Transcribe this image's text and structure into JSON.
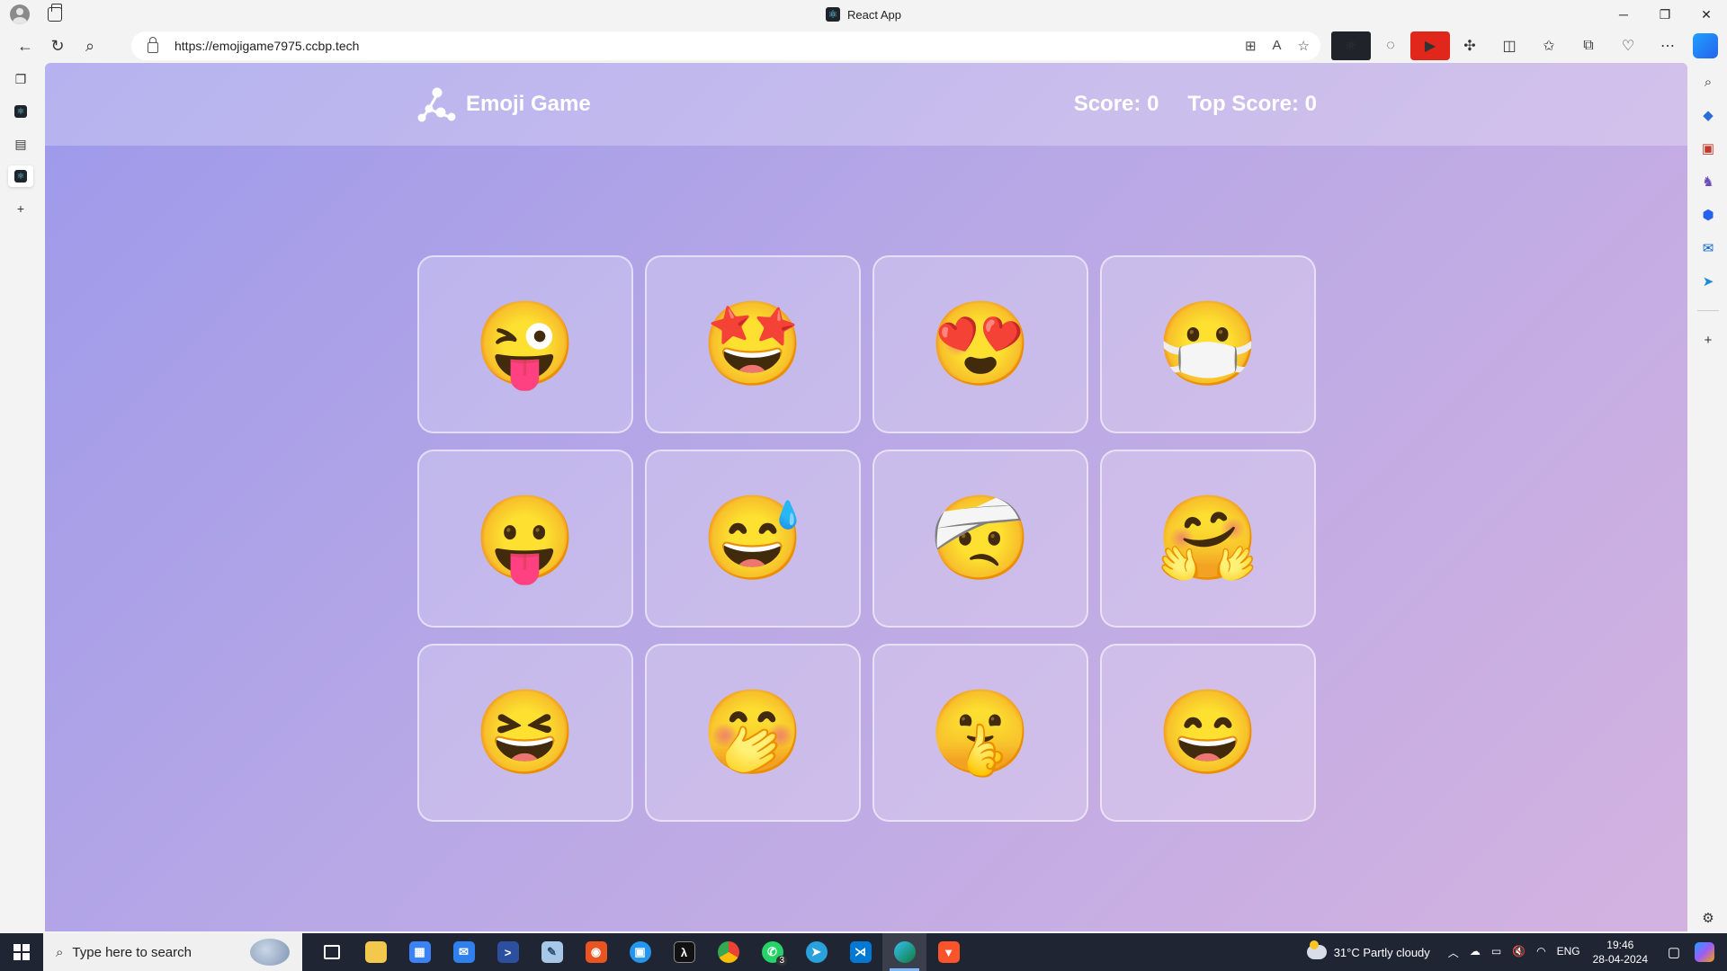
{
  "browser": {
    "window_title": "React App",
    "url": "https://emojigame7975.ccbp.tech",
    "window_controls": {
      "minimize": "─",
      "restore": "❐",
      "close": "✕"
    }
  },
  "app": {
    "name": "Emoji Game",
    "score_label": "Score: 0",
    "top_score_label": "Top Score: 0",
    "score": 0,
    "top_score": 0,
    "colors": {
      "header_text": "#ffffff",
      "bg_start": "#9d99ea",
      "bg_end": "#d3b2e0"
    }
  },
  "emojis": [
    {
      "name": "winking-face-with-tongue",
      "glyph": "😜"
    },
    {
      "name": "star-struck",
      "glyph": "🤩"
    },
    {
      "name": "smiling-face-with-heart-eyes",
      "glyph": "😍"
    },
    {
      "name": "face-with-medical-mask",
      "glyph": "😷"
    },
    {
      "name": "face-with-tongue",
      "glyph": "😛"
    },
    {
      "name": "grinning-face-with-sweat",
      "glyph": "😅"
    },
    {
      "name": "face-with-head-bandage",
      "glyph": "🤕"
    },
    {
      "name": "hugging-face",
      "glyph": "🤗"
    },
    {
      "name": "grinning-squinting-face",
      "glyph": "😆"
    },
    {
      "name": "face-with-hand-over-mouth",
      "glyph": "🤭"
    },
    {
      "name": "shushing-face",
      "glyph": "🤫"
    },
    {
      "name": "grinning-face-with-smiling-eyes",
      "glyph": "😄"
    }
  ],
  "taskbar": {
    "search_placeholder": "Type here to search",
    "whatsapp_badge": "3",
    "weather": "31°C  Partly cloudy",
    "language": "ENG",
    "time": "19:46",
    "date": "28-04-2024"
  }
}
